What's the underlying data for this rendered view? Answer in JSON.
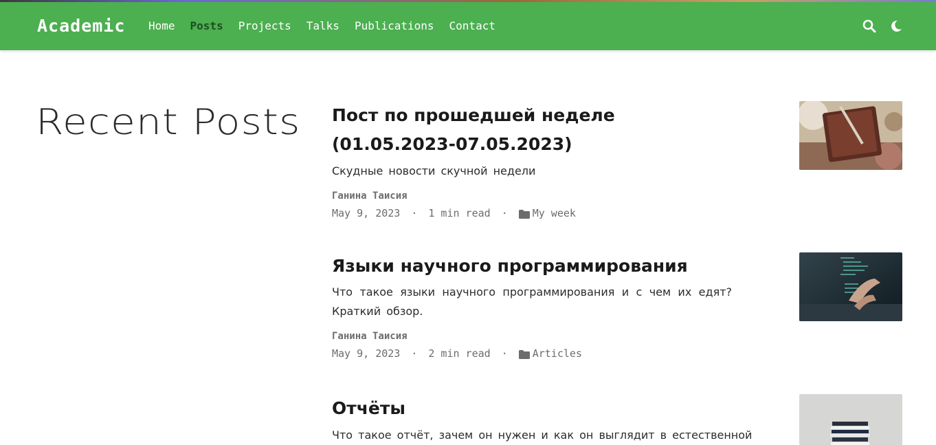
{
  "navbar": {
    "brand": "Academic",
    "links": [
      "Home",
      "Posts",
      "Projects",
      "Talks",
      "Publications",
      "Contact"
    ],
    "active": "Posts",
    "icons": [
      "search-icon",
      "moon-icon"
    ],
    "color": "#4caf50"
  },
  "page": {
    "title": "Recent Posts"
  },
  "posts": [
    {
      "title": "Пост по прошедшей неделе (01.05.2023-07.05.2023)",
      "summary": "Скудные новости скучной недели",
      "author": "Ганина Таисия",
      "date": "May 9, 2023",
      "read_time": "1 min read",
      "category": "My week",
      "separator": "·"
    },
    {
      "title": "Языки научного программирования",
      "summary": "Что такое языки научного программирования и с чем их едят? Краткий обзор.",
      "author": "Ганина Таисия",
      "date": "May 9, 2023",
      "read_time": "2 min read",
      "category": "Articles",
      "separator": "·"
    },
    {
      "title": "Отчёты",
      "summary": "Что такое отчёт, зачем он нужен и как он выглядит в естественной",
      "author": "",
      "date": "",
      "read_time": "",
      "category": "",
      "separator": ""
    }
  ]
}
